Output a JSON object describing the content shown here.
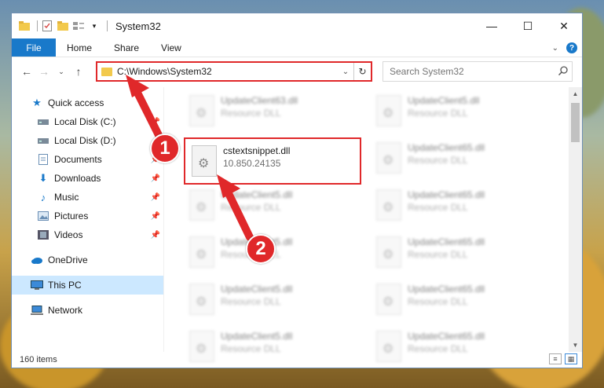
{
  "window": {
    "title": "System32",
    "controls": {
      "minimize": "—",
      "maximize": "☐",
      "close": "✕"
    }
  },
  "ribbon": {
    "tabs": [
      "File",
      "Home",
      "Share",
      "View"
    ],
    "expand_icon": "chevron-down-icon",
    "help_label": "?"
  },
  "address_bar": {
    "path": "C:\\Windows\\System32",
    "dropdown_glyph": "⌄",
    "refresh_glyph": "↻"
  },
  "search": {
    "placeholder": "Search System32"
  },
  "sidebar": {
    "items": [
      {
        "label": "Quick access",
        "icon": "star-icon",
        "pinned": false
      },
      {
        "label": "Local Disk (C:)",
        "icon": "drive-icon",
        "pinned": true
      },
      {
        "label": "Local Disk (D:)",
        "icon": "drive-icon",
        "pinned": false
      },
      {
        "label": "Documents",
        "icon": "documents-icon",
        "pinned": true
      },
      {
        "label": "Downloads",
        "icon": "download-icon",
        "pinned": true
      },
      {
        "label": "Music",
        "icon": "music-icon",
        "pinned": true
      },
      {
        "label": "Pictures",
        "icon": "pictures-icon",
        "pinned": true
      },
      {
        "label": "Videos",
        "icon": "videos-icon",
        "pinned": true
      },
      {
        "label": "OneDrive",
        "icon": "cloud-icon",
        "pinned": false
      },
      {
        "label": "This PC",
        "icon": "computer-icon",
        "pinned": false,
        "selected": true
      },
      {
        "label": "Network",
        "icon": "network-icon",
        "pinned": false
      }
    ]
  },
  "files": {
    "highlighted": {
      "name": "cstextsnippet.dll",
      "detail": "10.850.24135"
    },
    "background": [
      {
        "name": "UpdateClient63.dll",
        "detail": "Resource DLL"
      },
      {
        "name": "UpdateClient5.dll",
        "detail": "Resource DLL"
      },
      {
        "name": "UpdateClient65.dll",
        "detail": "Resource DLL"
      },
      {
        "name": "UpdateClient5.dll",
        "detail": "Resource DLL"
      },
      {
        "name": "UpdateClient65.dll",
        "detail": "Resource DLL"
      },
      {
        "name": "UpdateClient5.dll",
        "detail": "Resource DLL"
      },
      {
        "name": "UpdateClient65.dll",
        "detail": "Resource DLL"
      },
      {
        "name": "UpdateClient5.dll",
        "detail": "Resource DLL"
      },
      {
        "name": "UpdateClient65.dll",
        "detail": "Resource DLL"
      },
      {
        "name": "UpdateClient5.dll",
        "detail": "Resource DLL"
      },
      {
        "name": "UpdateClient65.dll",
        "detail": "Resource DLL"
      }
    ]
  },
  "status": {
    "item_count": "160 items"
  },
  "annotations": {
    "step1": "1",
    "step2": "2",
    "color": "#e0282a"
  }
}
